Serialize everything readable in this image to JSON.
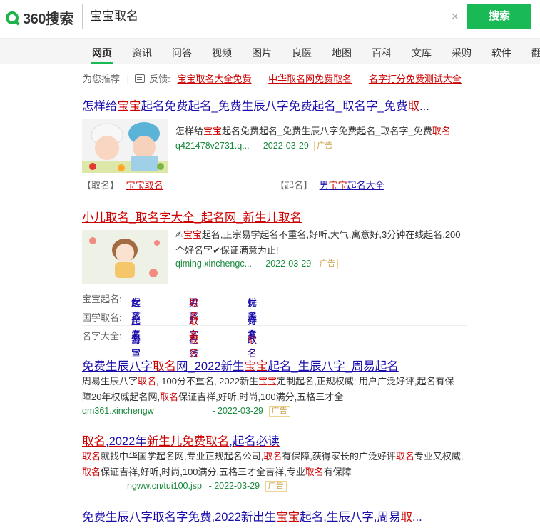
{
  "header": {
    "logo_text": "360搜索",
    "query": "宝宝取名",
    "search_button": "搜索",
    "clear_icon": "×"
  },
  "nav": {
    "tabs": [
      "网页",
      "资讯",
      "问答",
      "视频",
      "图片",
      "良医",
      "地图",
      "百科",
      "文库",
      "采购",
      "软件",
      "翻"
    ],
    "active": "网页"
  },
  "recommend": {
    "label": "为您推荐",
    "feedback": "反馈:",
    "links": [
      "宝宝取名大全免费",
      "中华取名网免费取名",
      "名字打分免费测试大全"
    ]
  },
  "results": [
    {
      "title_parts": [
        "怎样给",
        "宝宝",
        "起名免费起名_免费生辰八字免费起名_取名字_免费",
        "取",
        "..."
      ],
      "snippet_parts": [
        "怎样给",
        "宝宝",
        "起名免费起名_免费生辰八字免费起名_取名字_免费",
        "取名"
      ],
      "url": "q421478v2731.q...",
      "date": "- 2022-03-29",
      "ad": "广告",
      "sublinks": [
        {
          "tag": "【取名】",
          "text_a": "宝宝取名",
          "text_b": ""
        },
        {
          "tag": "【起名】",
          "text_a": "男",
          "text_b": "宝宝",
          "text_c": "起名大全"
        }
      ]
    },
    {
      "title": "小儿取名_取名字大全_起名网_新生儿取名",
      "snippet_l1_a": "✍",
      "snippet_l1_b": "宝宝",
      "snippet_l1_c": "起名,正宗易学起名不重名,好听,大气,寓意好,3分钟在线起名,200",
      "snippet_l2": "个好名字✔保证满意为止!",
      "url": "qiming.xinchengc...",
      "date": "- 2022-03-29",
      "ad": "广告",
      "grid": [
        {
          "key": "宝宝起名:",
          "v1a": "女孩",
          "v1b": "起名",
          "v2a": "男孩",
          "v2b": "取名",
          "v3a": "优美",
          "v3b": "好名"
        },
        {
          "key": "国学取名:",
          "v1a": "生辰",
          "v1b": "起名",
          "v2a": "八字",
          "v2b": "取名",
          "v3a": "诗意",
          "v3b": "好名"
        },
        {
          "key": "名字大全:",
          "v1a": "海量",
          "v1b": "名字",
          "v2a": "在线",
          "v2b": "取名",
          "v3a": "取名",
          "v3b": "改名"
        }
      ]
    },
    {
      "title_parts": [
        "免费生辰八字",
        "取名",
        "网_2022新生",
        "宝宝",
        "起名_生辰八字_周易起名"
      ],
      "snippet_l1_parts": [
        "周易生辰八字",
        "取名",
        ", 100分不重名, 2022新生",
        "宝宝",
        "定制起名,正规权威; 用户广泛好评,起名有保"
      ],
      "snippet_l2_parts": [
        "障20年权威起名网,",
        "取名",
        "保证吉祥,好听,时尚,100满分,五格三才全"
      ],
      "url": "qm361.xinchengw",
      "date": "- 2022-03-29",
      "ad": "广告"
    },
    {
      "title_parts": [
        "取名",
        ",2022年",
        "新生儿",
        "免费",
        "取名",
        ",起名必读"
      ],
      "snippet_l1_parts": [
        "取名",
        "就找中华国学起名网,专业正规起名公司,",
        "取名",
        "有保障,获得家长的广泛好评",
        "取名",
        "专业又权威,"
      ],
      "snippet_l2_parts": [
        "取名",
        "保证吉祥,好听,时尚,100满分,五格三才全吉祥,专业",
        "取名",
        "有保障"
      ],
      "url": "ngww.cn/tui100.jsp",
      "date": "- 2022-03-29",
      "ad": "广告"
    },
    {
      "title_parts": [
        "免费生辰八字取名字免费,2022新出生",
        "宝宝",
        "起名,生辰八字,周易",
        "取",
        "..."
      ]
    }
  ]
}
